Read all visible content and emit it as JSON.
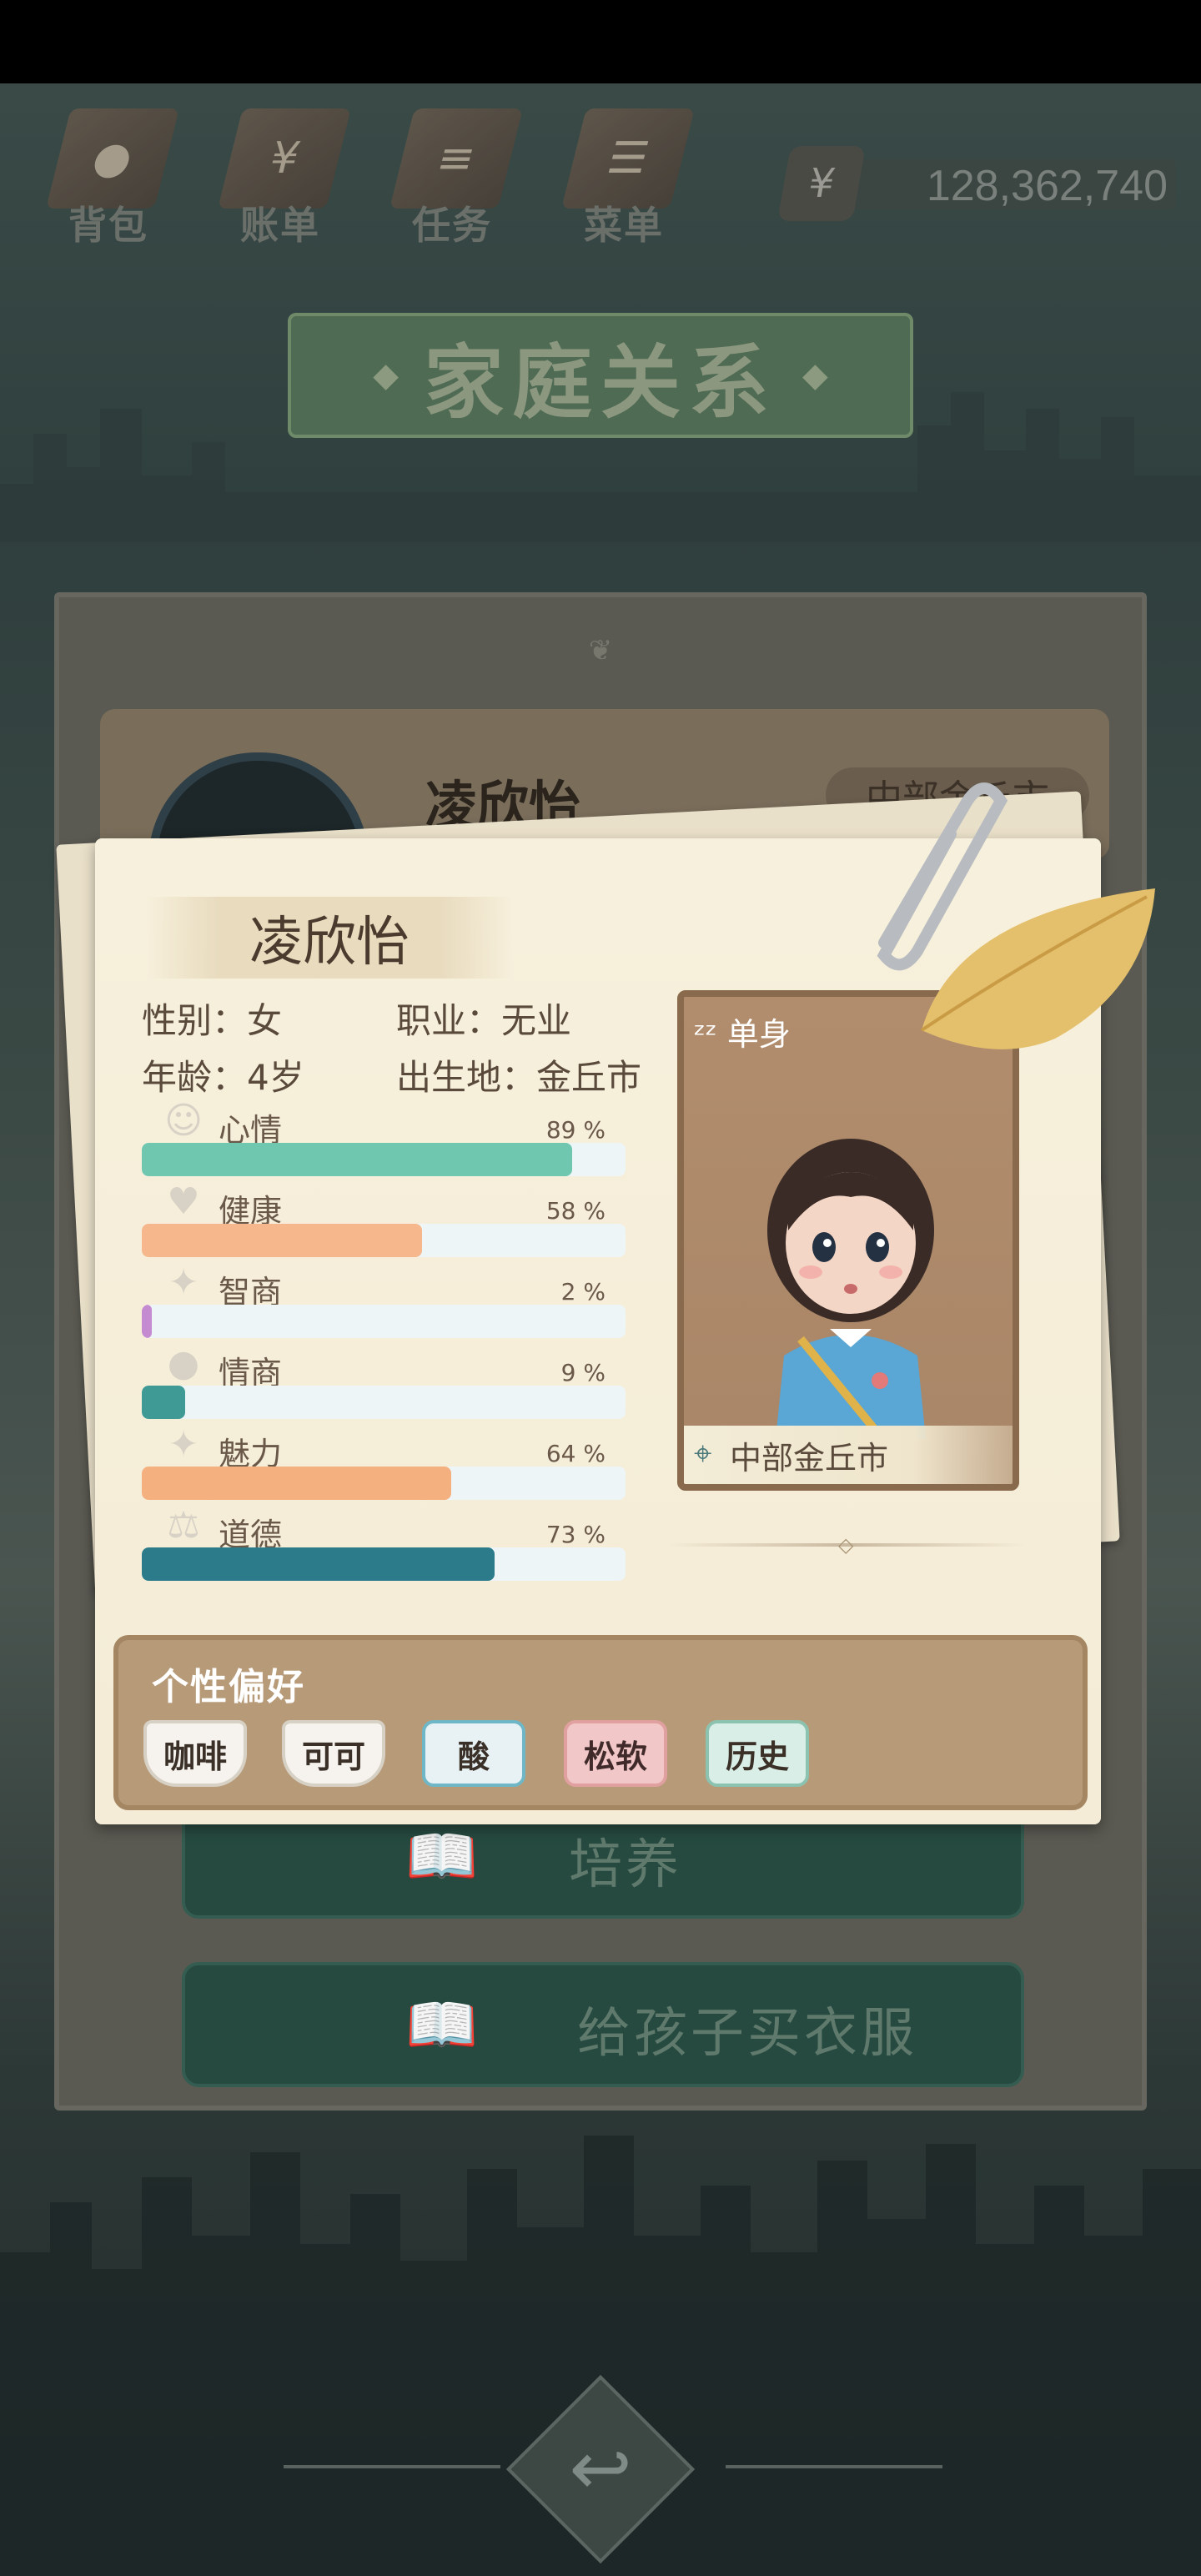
{
  "top_nav": [
    {
      "label": "背包",
      "icon": "backpack-icon",
      "glyph": "●"
    },
    {
      "label": "账单",
      "icon": "bill-icon",
      "glyph": "¥"
    },
    {
      "label": "任务",
      "icon": "task-icon",
      "glyph": "≡"
    },
    {
      "label": "菜单",
      "icon": "menu-icon",
      "glyph": "☰"
    }
  ],
  "money": {
    "symbol": "¥",
    "amount": "128,362,740"
  },
  "title": "家庭关系",
  "background_member": {
    "name": "凌欣怡",
    "location": "中部金丘市"
  },
  "card": {
    "name": "凌欣怡",
    "gender": "性别：女",
    "job": "职业：无业",
    "age": "年龄：4岁",
    "birthplace": "出生地：金丘市",
    "stats": [
      {
        "name": "心情",
        "percent": "89 %",
        "value": 89,
        "color": "#6fc7b0",
        "icon": "smile-icon",
        "glyph": "☺"
      },
      {
        "name": "健康",
        "percent": "58 %",
        "value": 58,
        "color": "#f5b78b",
        "icon": "heart-icon",
        "glyph": "♥"
      },
      {
        "name": "智商",
        "percent": "2 %",
        "value": 2,
        "color": "#c58bd0",
        "icon": "lightbulb-icon",
        "glyph": "✦"
      },
      {
        "name": "情商",
        "percent": "9 %",
        "value": 9,
        "color": "#3f9a95",
        "icon": "apple-icon",
        "glyph": "●"
      },
      {
        "name": "魅力",
        "percent": "64 %",
        "value": 64,
        "color": "#f4b07f",
        "icon": "sparkle-icon",
        "glyph": "✦"
      },
      {
        "name": "道德",
        "percent": "73 %",
        "value": 73,
        "color": "#2b7b8a",
        "icon": "scale-icon",
        "glyph": "⚖"
      }
    ],
    "relationship_status": "单身",
    "location": "中部金丘市"
  },
  "preferences": {
    "title": "个性偏好",
    "tags": [
      "咖啡",
      "可可",
      "酸",
      "松软",
      "历史"
    ]
  },
  "buttons": {
    "train": "培养",
    "buy_clothes": "给孩子买衣服"
  },
  "colors": {
    "accent_green": "#264a40",
    "card_bg": "#f4ecd6",
    "prefs_bg": "#b79a78"
  }
}
